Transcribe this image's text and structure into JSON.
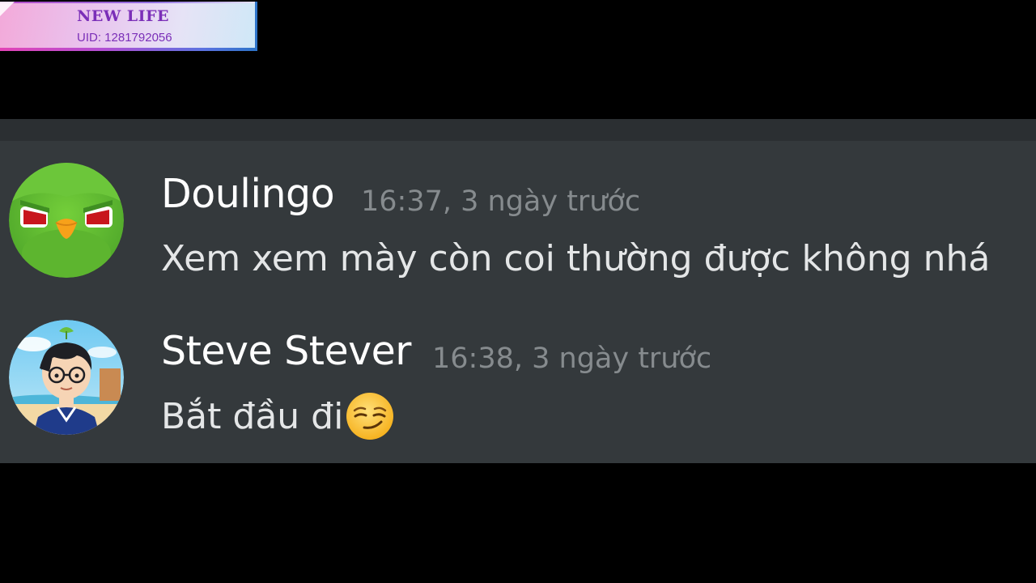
{
  "overlay": {
    "name": "NEW LIFE",
    "uid": "UID: 1281792056"
  },
  "messages": [
    {
      "author": "Doulingo",
      "timestamp": "16:37, 3 ngày trước",
      "text": "Xem xem mày còn coi thường được không nhá",
      "avatar_icon": "duolingo-owl-icon",
      "emoji": null
    },
    {
      "author": "Steve Stever",
      "timestamp": "16:38, 3 ngày trước",
      "text": "Bắt đầu đi",
      "avatar_icon": "cartoon-boy-avatar-icon",
      "emoji": "smirking-face-emoji"
    }
  ],
  "colors": {
    "chat_background": "#34393c",
    "author": "#ffffff",
    "timestamp": "#868b8e",
    "message_text": "#e4e6e7"
  }
}
